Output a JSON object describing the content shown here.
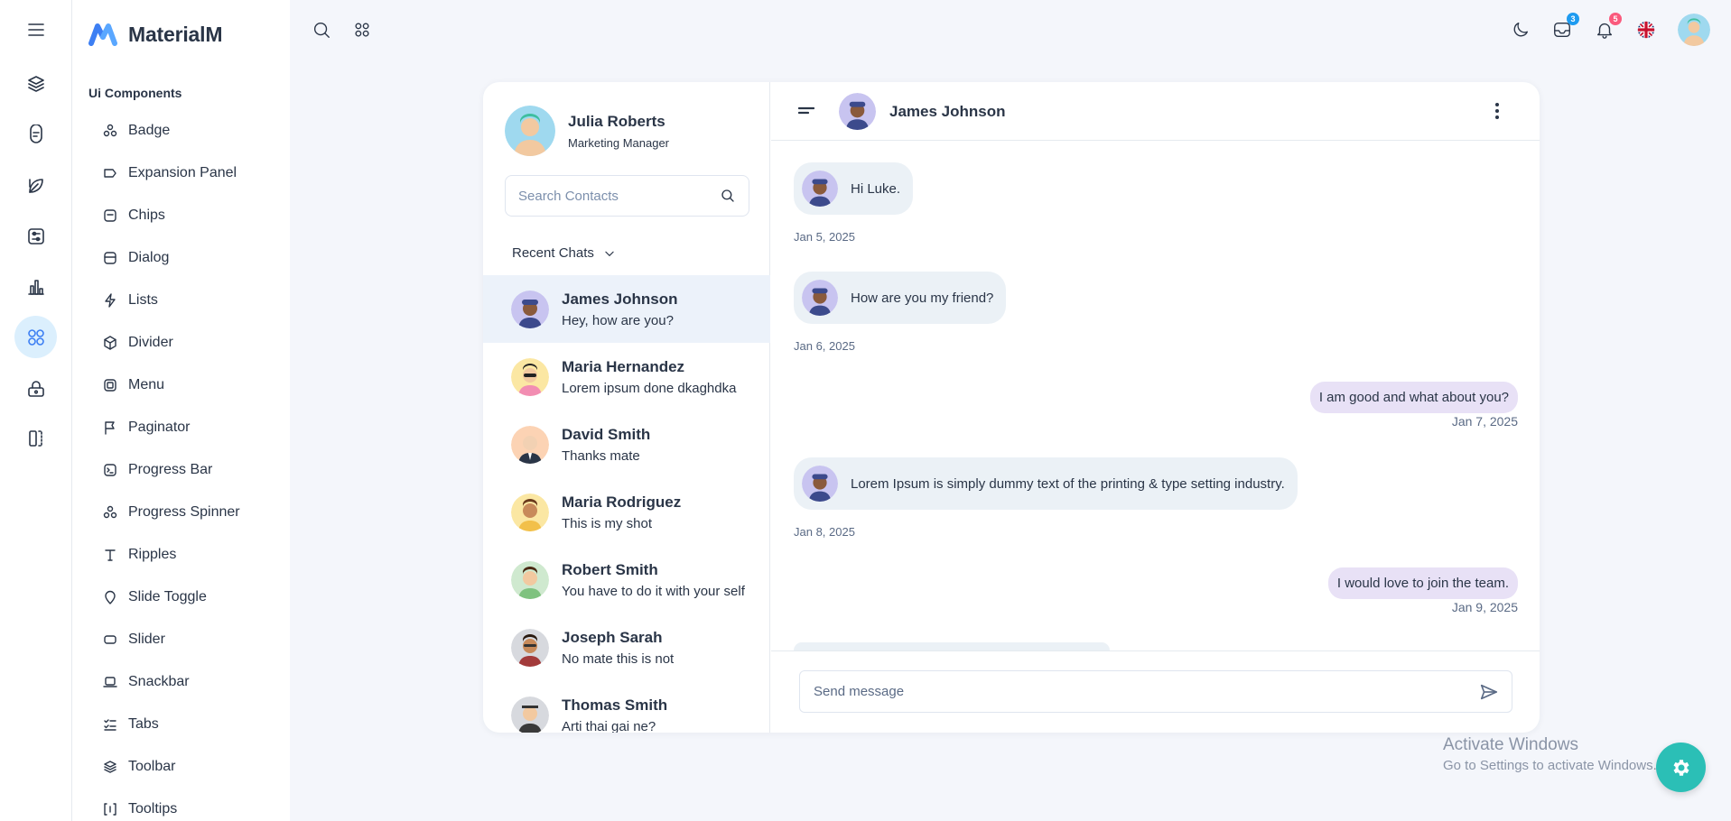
{
  "brand": {
    "name": "MaterialM"
  },
  "rail": {
    "icons": [
      "menu-icon",
      "layers-icon",
      "copy-icon",
      "leaf-icon",
      "sliders-icon",
      "chart-icon",
      "apps-icon",
      "lock-icon",
      "panels-icon"
    ],
    "active": "apps-icon"
  },
  "sidemenu": {
    "section_title": "Ui Components",
    "items": [
      {
        "label": "Badge",
        "icon": "apps-icon"
      },
      {
        "label": "Expansion Panel",
        "icon": "label-icon"
      },
      {
        "label": "Chips",
        "icon": "note-icon"
      },
      {
        "label": "Dialog",
        "icon": "database-icon"
      },
      {
        "label": "Lists",
        "icon": "bolt-icon"
      },
      {
        "label": "Divider",
        "icon": "cube-icon"
      },
      {
        "label": "Menu",
        "icon": "layout-icon"
      },
      {
        "label": "Paginator",
        "icon": "flag-icon"
      },
      {
        "label": "Progress Bar",
        "icon": "terminal-icon"
      },
      {
        "label": "Progress Spinner",
        "icon": "apps-icon"
      },
      {
        "label": "Ripples",
        "icon": "text-icon"
      },
      {
        "label": "Slide Toggle",
        "icon": "pin-icon"
      },
      {
        "label": "Slider",
        "icon": "rect-icon"
      },
      {
        "label": "Snackbar",
        "icon": "laptop-icon"
      },
      {
        "label": "Tabs",
        "icon": "checklist-icon"
      },
      {
        "label": "Toolbar",
        "icon": "layers-icon"
      },
      {
        "label": "Tooltips",
        "icon": "brackets-icon"
      }
    ]
  },
  "topbar": {
    "messages_count": "3",
    "notifications_count": "5"
  },
  "profile": {
    "name": "Julia Roberts",
    "role": "Marketing Manager"
  },
  "search": {
    "placeholder": "Search Contacts"
  },
  "recent_label": "Recent Chats",
  "contacts": [
    {
      "name": "James Johnson",
      "message": "Hey, how are you?"
    },
    {
      "name": "Maria Hernandez",
      "message": "Lorem ipsum done dkaghdka"
    },
    {
      "name": "David Smith",
      "message": "Thanks mate"
    },
    {
      "name": "Maria Rodriguez",
      "message": "This is my shot"
    },
    {
      "name": "Robert Smith",
      "message": "You have to do it with your self"
    },
    {
      "name": "Joseph Sarah",
      "message": "No mate this is not"
    },
    {
      "name": "Thomas Smith",
      "message": "Arti thai gai ne?"
    }
  ],
  "chat": {
    "contact_name": "James Johnson",
    "messages": [
      {
        "direction": "in",
        "text": "Hi Luke.",
        "date": "Jan 5, 2025"
      },
      {
        "direction": "in",
        "text": "How are you my friend?",
        "date": "Jan 6, 2025"
      },
      {
        "direction": "out",
        "text": "I am good and what about you?",
        "date": "Jan 7, 2025"
      },
      {
        "direction": "in",
        "text": "Lorem Ipsum is simply dummy text of the printing & type setting industry.",
        "date": "Jan 8, 2025"
      },
      {
        "direction": "out",
        "text": "I would love to join the team.",
        "date": "Jan 9, 2025"
      }
    ],
    "composer_placeholder": "Send message"
  },
  "watermark": {
    "line1": "Activate Windows",
    "line2": "Go to Settings to activate Windows."
  },
  "colors": {
    "accent": "#3d7ff3",
    "messages_badge": "#1e9bf0",
    "notifications_badge": "#fa5a7d",
    "fab": "#2bbfb6"
  }
}
